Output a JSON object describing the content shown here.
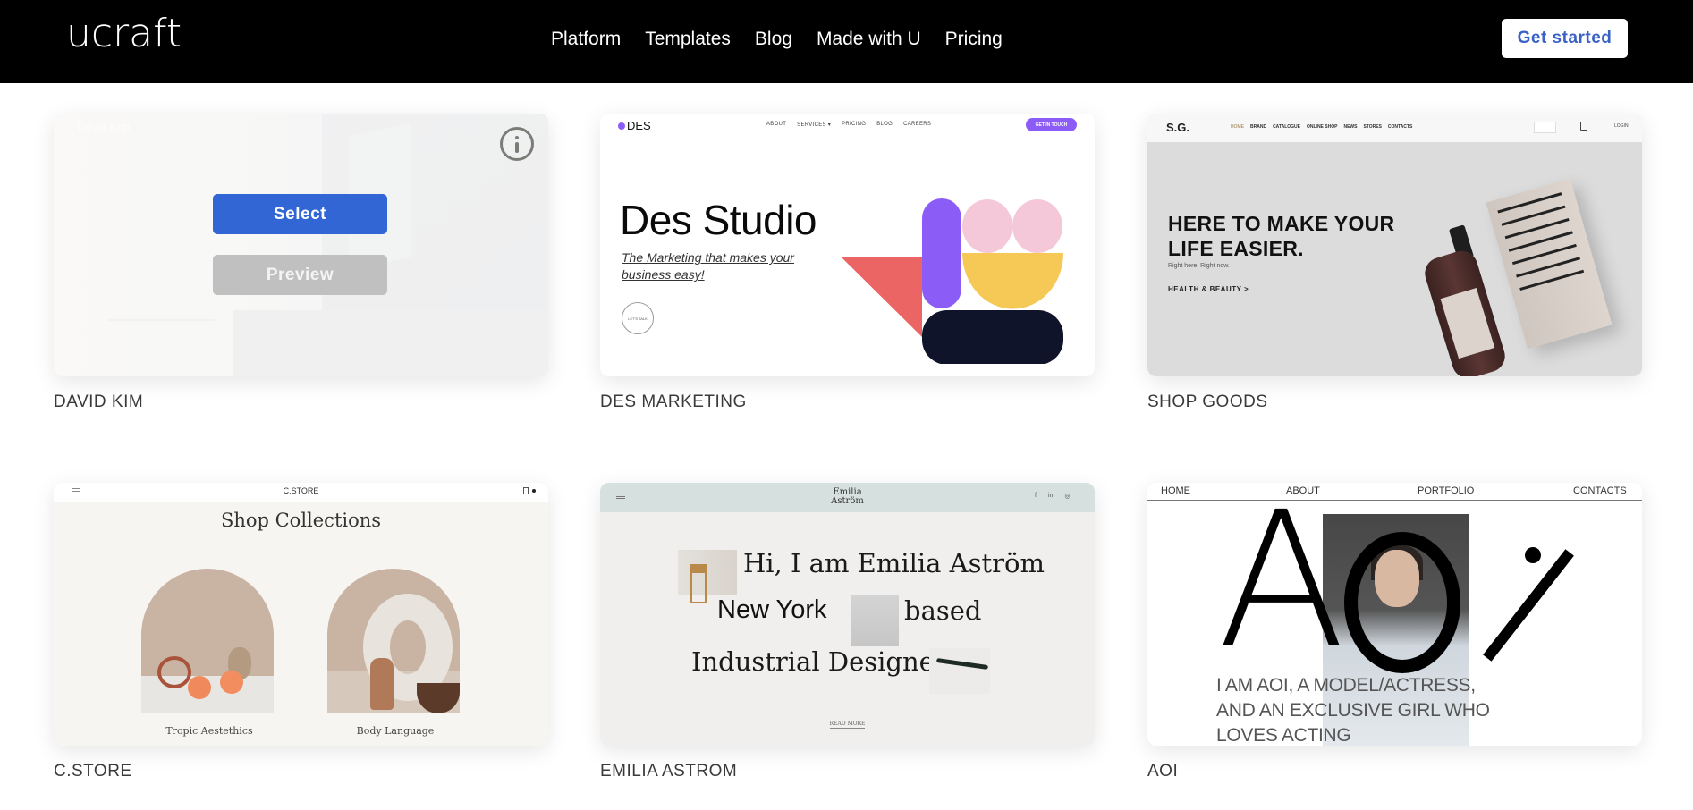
{
  "header": {
    "logo": "ucraft",
    "nav": [
      "Platform",
      "Templates",
      "Blog",
      "Made with U",
      "Pricing"
    ],
    "cta_label": "Get started",
    "cta_color": "#3a62c6"
  },
  "overlay": {
    "select_label": "Select",
    "preview_label": "Preview",
    "select_color": "#3166d4",
    "preview_color": "#c1c0c1",
    "info_icon": "info-circle-icon"
  },
  "templates": [
    {
      "name": "DAVID KIM",
      "preview": {
        "site_title": "David Kim"
      }
    },
    {
      "name": "DES MARKETING",
      "preview": {
        "logo": "DES",
        "nav": [
          "ABOUT",
          "SERVICES ▾",
          "PRICING",
          "BLOG",
          "CAREERS"
        ],
        "cta": "GET IN TOUCH",
        "headline": "Des Studio",
        "subheadline": "The Marketing that makes your business easy!",
        "circle_btn": "LET'S TALK",
        "accent": "#8b5cf6"
      }
    },
    {
      "name": "SHOP GOODS",
      "preview": {
        "logo": "S.G.",
        "nav": [
          "HOME",
          "BRAND",
          "CATALOGUE",
          "ONLINE SHOP",
          "NEWS",
          "STORES",
          "CONTACTS"
        ],
        "login": "LOGIN",
        "headline": "HERE TO MAKE YOUR LIFE EASIER.",
        "subheadline": "Right here. Right now.",
        "link": "HEALTH & BEAUTY >"
      }
    },
    {
      "name": "C.STORE",
      "preview": {
        "logo": "C.STORE",
        "headline": "Shop Collections",
        "collections": [
          "Tropic Aestethics",
          "Body Language"
        ]
      }
    },
    {
      "name": "EMILIA ASTROM",
      "preview": {
        "logo_line1": "Emilia",
        "logo_line2": "Aström",
        "social": [
          "f",
          "in",
          "◎"
        ],
        "line1": "Hi, I am Emilia Aström",
        "line2a": "New York",
        "line2b": "based",
        "line3": "Industrial Designer",
        "read_more": "READ MORE"
      }
    },
    {
      "name": "AOI",
      "preview": {
        "nav": [
          "HOME",
          "ABOUT",
          "PORTFOLIO",
          "CONTACTS"
        ],
        "big_letter": "A",
        "tagline_1": "I AM AOI, A MODEL/ACTRESS,",
        "tagline_2": "AND AN EXCLUSIVE GIRL WHO",
        "tagline_3": "LOVES ACTING"
      }
    }
  ]
}
